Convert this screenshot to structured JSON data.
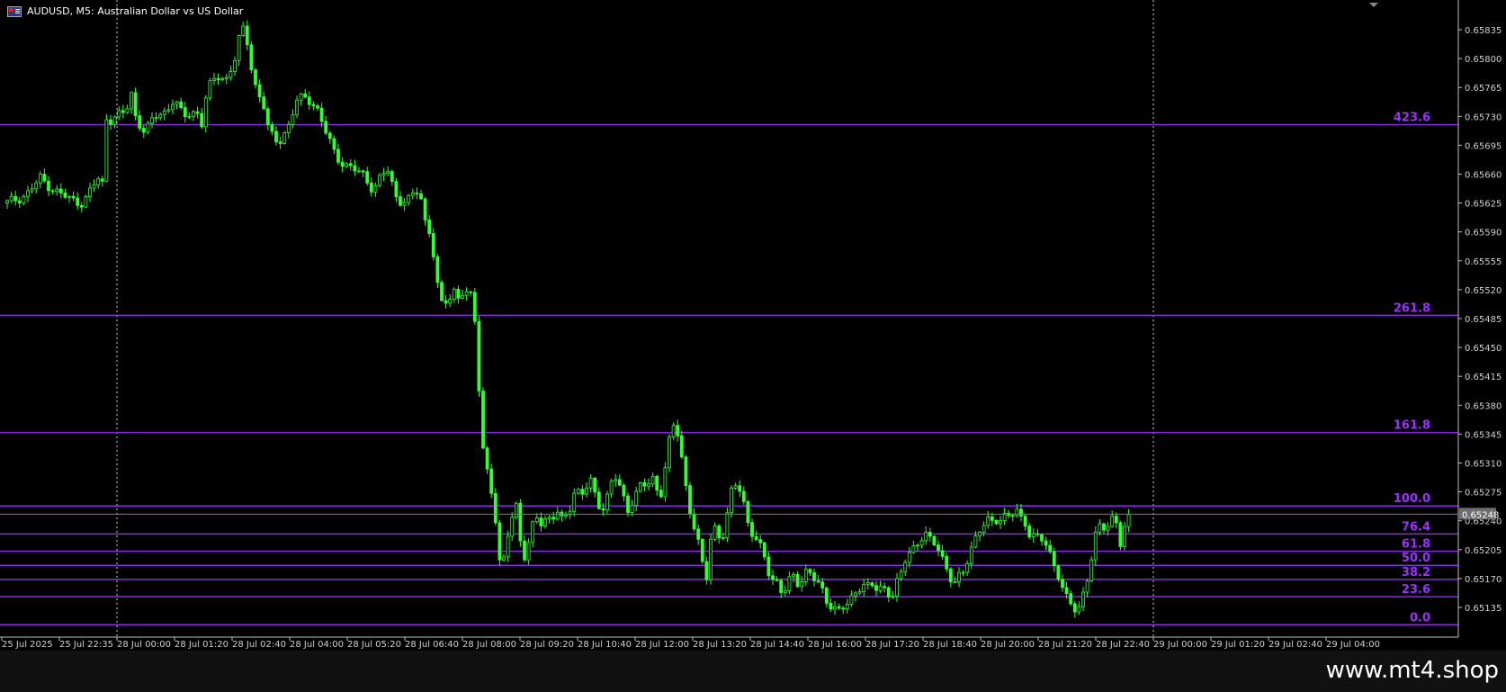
{
  "window": {
    "symbol_title": "AUDUSD, M5:  Australian Dollar vs US Dollar",
    "flag_icon": "flag-icon",
    "watermark": "www.mt4.shop"
  },
  "chart_data": {
    "type": "candlestick",
    "price_ticks": [
      "0.65835",
      "0.65800",
      "0.65765",
      "0.65730",
      "0.65695",
      "0.65660",
      "0.65625",
      "0.65590",
      "0.65555",
      "0.65520",
      "0.65485",
      "0.65450",
      "0.65415",
      "0.65380",
      "0.65345",
      "0.65310",
      "0.65275",
      "0.65240",
      "0.65205",
      "0.65170",
      "0.65135"
    ],
    "ylim": [
      0.651,
      0.6586
    ],
    "current_price": "0.65248",
    "time_labels": [
      "25 Jul 2025",
      "25 Jul 22:35",
      "28 Jul 00:00",
      "28 Jul 01:20",
      "28 Jul 02:40",
      "28 Jul 04:00",
      "28 Jul 05:20",
      "28 Jul 06:40",
      "28 Jul 08:00",
      "28 Jul 09:20",
      "28 Jul 10:40",
      "28 Jul 12:00",
      "28 Jul 13:20",
      "28 Jul 14:40",
      "28 Jul 16:00",
      "28 Jul 17:20",
      "28 Jul 18:40",
      "28 Jul 20:00",
      "28 Jul 21:20",
      "28 Jul 22:40",
      "29 Jul 00:00",
      "29 Jul 01:20",
      "29 Jul 02:40",
      "29 Jul 04:00"
    ],
    "fib_levels": [
      {
        "label": "423.6",
        "price": 0.6572
      },
      {
        "label": "261.8",
        "price": 0.65489
      },
      {
        "label": "161.8",
        "price": 0.65347
      },
      {
        "label": "100.0",
        "price": 0.65258
      },
      {
        "label": "76.4",
        "price": 0.65224
      },
      {
        "label": "61.8",
        "price": 0.65203
      },
      {
        "label": "50.0",
        "price": 0.65186
      },
      {
        "label": "38.2",
        "price": 0.65169
      },
      {
        "label": "23.6",
        "price": 0.65148
      },
      {
        "label": "0.0",
        "price": 0.65114
      }
    ],
    "price_path": [
      [
        0,
        0.65625
      ],
      [
        4,
        0.65635
      ],
      [
        7,
        0.65655
      ],
      [
        10,
        0.6564
      ],
      [
        13,
        0.6563
      ],
      [
        16,
        0.65625
      ],
      [
        19,
        0.65655
      ],
      [
        20,
        0.65645
      ],
      [
        20.3,
        0.65745
      ],
      [
        21,
        0.65725
      ],
      [
        23,
        0.6573
      ],
      [
        25,
        0.65735
      ],
      [
        26,
        0.6576
      ],
      [
        27,
        0.6573
      ],
      [
        29,
        0.6571
      ],
      [
        31,
        0.6573
      ],
      [
        33,
        0.65735
      ],
      [
        35,
        0.6575
      ],
      [
        37,
        0.6573
      ],
      [
        39,
        0.65735
      ],
      [
        40,
        0.65735
      ],
      [
        41,
        0.6572
      ],
      [
        42,
        0.6576
      ],
      [
        44,
        0.6578
      ],
      [
        46,
        0.65775
      ],
      [
        48,
        0.658
      ],
      [
        49,
        0.6583
      ],
      [
        50,
        0.6584
      ],
      [
        51,
        0.658
      ],
      [
        52,
        0.6577
      ],
      [
        54,
        0.6574
      ],
      [
        55,
        0.6571
      ],
      [
        57,
        0.657
      ],
      [
        59,
        0.65715
      ],
      [
        61,
        0.6575
      ],
      [
        63,
        0.65755
      ],
      [
        65,
        0.6574
      ],
      [
        67,
        0.6571
      ],
      [
        69,
        0.65685
      ],
      [
        71,
        0.6567
      ],
      [
        73,
        0.65665
      ],
      [
        75,
        0.6566
      ],
      [
        77,
        0.6564
      ],
      [
        79,
        0.6566
      ],
      [
        80,
        0.65665
      ],
      [
        82,
        0.6563
      ],
      [
        84,
        0.65625
      ],
      [
        86,
        0.6564
      ],
      [
        87,
        0.6563
      ],
      [
        88,
        0.656
      ],
      [
        89,
        0.6559
      ],
      [
        90,
        0.65545
      ],
      [
        91,
        0.655
      ],
      [
        92,
        0.65505
      ],
      [
        93,
        0.6551
      ],
      [
        94,
        0.6552
      ],
      [
        95,
        0.6551
      ],
      [
        96,
        0.6552
      ],
      [
        97,
        0.6551
      ],
      [
        98,
        0.6551
      ],
      [
        99,
        0.6542
      ],
      [
        99.5,
        0.6537
      ],
      [
        100,
        0.6533
      ],
      [
        101,
        0.653
      ],
      [
        102,
        0.6527
      ],
      [
        103,
        0.6522
      ],
      [
        103.7,
        0.65175
      ],
      [
        104.3,
        0.6519
      ],
      [
        105,
        0.6522
      ],
      [
        106,
        0.65245
      ],
      [
        107,
        0.6526
      ],
      [
        107.8,
        0.6522
      ],
      [
        108.5,
        0.6519
      ],
      [
        109.5,
        0.65205
      ],
      [
        110.5,
        0.65235
      ],
      [
        111.5,
        0.6525
      ],
      [
        112.5,
        0.65235
      ],
      [
        113.5,
        0.65245
      ],
      [
        114.5,
        0.6524
      ],
      [
        115.5,
        0.6525
      ],
      [
        116.5,
        0.6524
      ],
      [
        117.5,
        0.6525
      ],
      [
        118.5,
        0.6526
      ],
      [
        119.5,
        0.6528
      ],
      [
        120.5,
        0.6527
      ],
      [
        121.5,
        0.65275
      ],
      [
        122.5,
        0.6529
      ],
      [
        123.5,
        0.65275
      ],
      [
        124.5,
        0.6526
      ],
      [
        125.5,
        0.65255
      ],
      [
        126.5,
        0.65275
      ],
      [
        127.5,
        0.65295
      ],
      [
        128.5,
        0.65285
      ],
      [
        129.5,
        0.6527
      ],
      [
        130.5,
        0.65255
      ],
      [
        131.5,
        0.65265
      ],
      [
        132.5,
        0.65275
      ],
      [
        133.5,
        0.65285
      ],
      [
        134.5,
        0.6528
      ],
      [
        135.5,
        0.65295
      ],
      [
        136.5,
        0.6528
      ],
      [
        137.5,
        0.65275
      ],
      [
        138,
        0.6529
      ],
      [
        139,
        0.6533
      ],
      [
        140,
        0.65355
      ],
      [
        141,
        0.65345
      ],
      [
        142,
        0.6531
      ],
      [
        143,
        0.6527
      ],
      [
        144,
        0.6524
      ],
      [
        145,
        0.6522
      ],
      [
        146,
        0.6519
      ],
      [
        147,
        0.6517
      ],
      [
        148,
        0.65225
      ],
      [
        149,
        0.65235
      ],
      [
        150,
        0.65215
      ],
      [
        151,
        0.6523
      ],
      [
        152,
        0.6527
      ],
      [
        153,
        0.65285
      ],
      [
        154,
        0.6528
      ],
      [
        155,
        0.6526
      ],
      [
        156,
        0.6523
      ],
      [
        157,
        0.6522
      ],
      [
        158,
        0.6521
      ],
      [
        159,
        0.652
      ],
      [
        160,
        0.6518
      ],
      [
        161,
        0.6517
      ],
      [
        162,
        0.65165
      ],
      [
        163,
        0.6515
      ],
      [
        164,
        0.6516
      ],
      [
        165,
        0.65175
      ],
      [
        166,
        0.65165
      ],
      [
        167,
        0.6517
      ],
      [
        168,
        0.6518
      ],
      [
        169,
        0.65175
      ],
      [
        170,
        0.65165
      ],
      [
        171,
        0.6516
      ],
      [
        172,
        0.65145
      ],
      [
        173,
        0.6514
      ],
      [
        174,
        0.65135
      ],
      [
        175,
        0.6513
      ],
      [
        176,
        0.65135
      ],
      [
        177,
        0.6514
      ],
      [
        178,
        0.6515
      ],
      [
        179,
        0.6516
      ],
      [
        180,
        0.65165
      ],
      [
        181,
        0.6516
      ],
      [
        182,
        0.6516
      ],
      [
        183,
        0.65155
      ],
      [
        184,
        0.6516
      ],
      [
        185,
        0.65155
      ],
      [
        186,
        0.6515
      ],
      [
        187,
        0.65165
      ],
      [
        188,
        0.65175
      ],
      [
        189,
        0.65195
      ],
      [
        190,
        0.65205
      ],
      [
        191,
        0.6521
      ],
      [
        192,
        0.6522
      ],
      [
        193,
        0.65225
      ],
      [
        194,
        0.65215
      ],
      [
        195,
        0.6521
      ],
      [
        196,
        0.65205
      ],
      [
        197,
        0.6519
      ],
      [
        198,
        0.65175
      ],
      [
        199,
        0.65165
      ],
      [
        200,
        0.6517
      ],
      [
        201,
        0.65175
      ],
      [
        202,
        0.65195
      ],
      [
        203,
        0.65215
      ],
      [
        204,
        0.65225
      ],
      [
        205,
        0.65235
      ],
      [
        206,
        0.6524
      ],
      [
        207,
        0.65235
      ],
      [
        208,
        0.6524
      ],
      [
        209,
        0.65245
      ],
      [
        210,
        0.6525
      ],
      [
        211,
        0.65245
      ],
      [
        212,
        0.65255
      ],
      [
        213,
        0.6524
      ],
      [
        214,
        0.65235
      ],
      [
        215,
        0.65225
      ],
      [
        216,
        0.65225
      ],
      [
        217,
        0.6522
      ],
      [
        218,
        0.65215
      ],
      [
        219,
        0.652
      ],
      [
        220,
        0.65185
      ],
      [
        221,
        0.65175
      ],
      [
        222,
        0.6516
      ],
      [
        223,
        0.65145
      ],
      [
        224,
        0.65135
      ],
      [
        225,
        0.65125
      ],
      [
        226,
        0.65145
      ],
      [
        227,
        0.6517
      ],
      [
        228,
        0.652
      ],
      [
        229,
        0.6523
      ],
      [
        230,
        0.65235
      ],
      [
        231,
        0.65225
      ],
      [
        232,
        0.6524
      ],
      [
        233,
        0.65245
      ],
      [
        234,
        0.65215
      ],
      [
        235,
        0.65235
      ],
      [
        236,
        0.65245
      ]
    ]
  }
}
